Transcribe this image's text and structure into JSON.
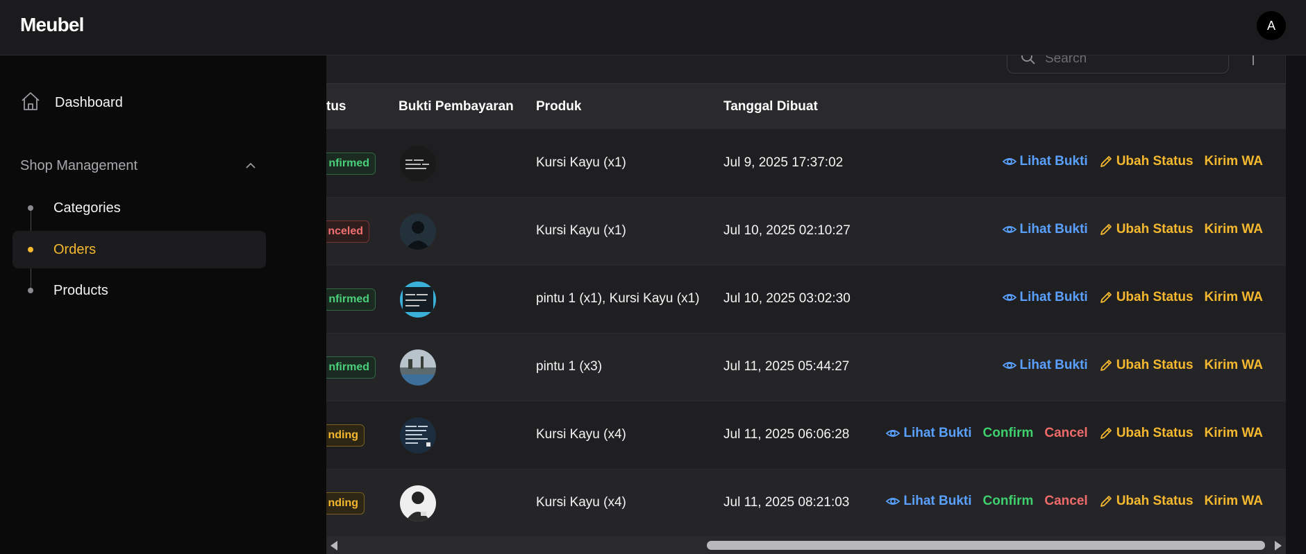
{
  "app": {
    "brand": "Meubel",
    "avatar_initial": "A"
  },
  "sidebar": {
    "dashboard_label": "Dashboard",
    "section_label": "Shop Management",
    "items": [
      {
        "label": "Categories",
        "active": false
      },
      {
        "label": "Orders",
        "active": true
      },
      {
        "label": "Products",
        "active": false
      }
    ]
  },
  "toolbar": {
    "search_placeholder": "Search"
  },
  "table": {
    "headers": {
      "status": "tus",
      "proof": "Bukti Pembayaran",
      "product": "Produk",
      "created": "Tanggal Dibuat"
    },
    "rows": [
      {
        "status": "nfirmed",
        "status_kind": "confirmed",
        "product": "Kursi Kayu (x1)",
        "created": "Jul 9, 2025 17:37:02",
        "actions": [
          "view",
          "status",
          "wa"
        ]
      },
      {
        "status": "nceled",
        "status_kind": "canceled",
        "product": "Kursi Kayu (x1)",
        "created": "Jul 10, 2025 02:10:27",
        "actions": [
          "view",
          "status",
          "wa"
        ]
      },
      {
        "status": "nfirmed",
        "status_kind": "confirmed",
        "product": "pintu 1 (x1), Kursi Kayu (x1)",
        "created": "Jul 10, 2025 03:02:30",
        "actions": [
          "view",
          "status",
          "wa"
        ]
      },
      {
        "status": "nfirmed",
        "status_kind": "confirmed",
        "product": "pintu 1 (x3)",
        "created": "Jul 11, 2025 05:44:27",
        "actions": [
          "view",
          "status",
          "wa"
        ]
      },
      {
        "status": "nding",
        "status_kind": "pending",
        "product": "Kursi Kayu (x4)",
        "created": "Jul 11, 2025 06:06:28",
        "actions": [
          "view",
          "confirm",
          "cancel",
          "status",
          "wa"
        ]
      },
      {
        "status": "nding",
        "status_kind": "pending",
        "product": "Kursi Kayu (x4)",
        "created": "Jul 11, 2025 08:21:03",
        "actions": [
          "view",
          "confirm",
          "cancel",
          "status",
          "wa"
        ]
      }
    ],
    "action_labels": {
      "view": "Lihat Bukti",
      "confirm": "Confirm",
      "cancel": "Cancel",
      "status": "Ubah Status",
      "wa": "Kirim WA"
    }
  },
  "colors": {
    "accent": "#f5b82e",
    "link": "#5aa0ff",
    "success": "#3fcf6e",
    "danger": "#ef6b6b"
  }
}
